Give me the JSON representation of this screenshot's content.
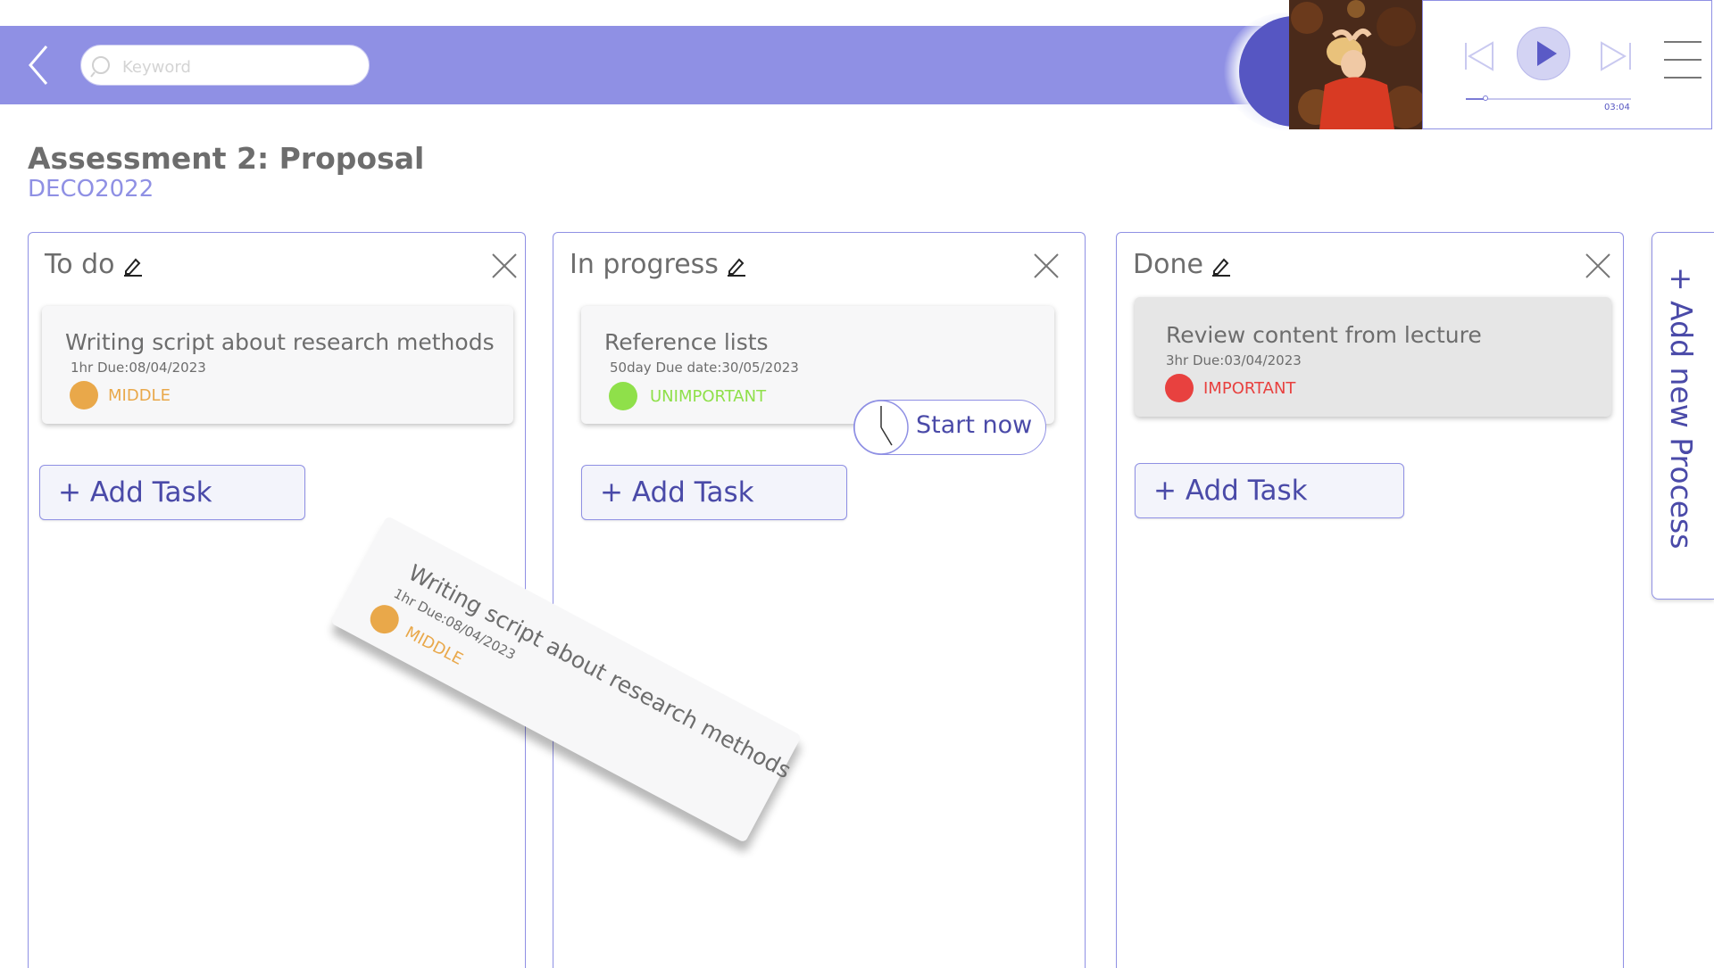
{
  "search": {
    "placeholder": "Keyword"
  },
  "player": {
    "time": "03:04",
    "progress": 0.12,
    "accent": "#5656c2"
  },
  "header": {
    "title": "Assessment 2: Proposal",
    "course": "DECO2022"
  },
  "columns": [
    {
      "title": "To do",
      "add_label": "+ Add Task",
      "tasks": [
        {
          "title": "Writing script about research methods",
          "meta": "1hr Due:08/04/2023",
          "priority": "MIDDLE",
          "priority_color": "#e9a84a"
        }
      ]
    },
    {
      "title": "In progress",
      "add_label": "+ Add Task",
      "tasks": [
        {
          "title": "Reference lists",
          "meta": "50day Due date:30/05/2023",
          "priority": "UNIMPORTANT",
          "priority_color": "#8fe04a"
        }
      ],
      "start_label": "Start now"
    },
    {
      "title": "Done",
      "add_label": "+ Add Task",
      "tasks": [
        {
          "title": "Review content from lecture",
          "meta": "3hr  Due:03/04/2023",
          "priority": "IMPORTANT",
          "priority_color": "#e8413f"
        }
      ]
    }
  ],
  "add_process_label": "+ Add new Process",
  "dragging": {
    "title": "Writing script about research methods",
    "meta": "1hr Due:08/04/2023",
    "priority": "MIDDLE"
  },
  "colors": {
    "accent": "#8f90e4",
    "text": "#6d6d6d",
    "button_text": "#4a4aa8"
  }
}
